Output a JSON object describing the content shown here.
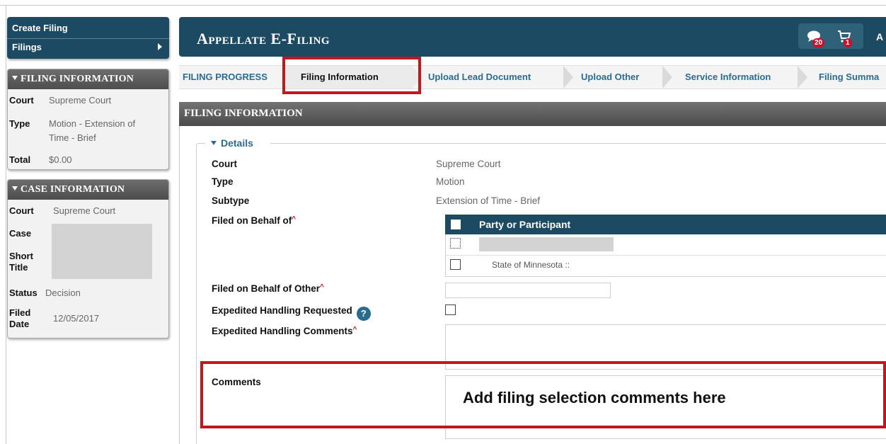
{
  "nav": {
    "create_filing": "Create Filing",
    "filings": "Filings"
  },
  "filing_info": {
    "header": "FILING INFORMATION",
    "court_key": "Court",
    "court": "Supreme Court",
    "type_key": "Type",
    "type_line1": "Motion - Extension of",
    "type_line2": "Time - Brief",
    "total_key": "Total",
    "total": "$0.00"
  },
  "case_info": {
    "header": "CASE INFORMATION",
    "court_key": "Court",
    "court": "Supreme Court",
    "case_key": "Case",
    "short_title_key_1": "Short",
    "short_title_key_2": "Title",
    "status_key": "Status",
    "status": "Decision",
    "filed_date_key_1": "Filed",
    "filed_date_key_2": "Date",
    "filed_date": "12/05/2017"
  },
  "header": {
    "title": "Appellate E-Filing",
    "messages_count": "20",
    "cart_count": "1",
    "user_initial": "A"
  },
  "progress": {
    "label": "FILING PROGRESS",
    "steps": [
      "Filing Information",
      "Upload Lead Document",
      "Upload Other",
      "Service Information",
      "Filing Summa"
    ],
    "current_step": 0
  },
  "section": {
    "title": "FILING INFORMATION",
    "legend": "Details"
  },
  "form": {
    "court_label": "Court",
    "court_value": "Supreme Court",
    "type_label": "Type",
    "type_value": "Motion",
    "subtype_label": "Subtype",
    "subtype_value": "Extension of Time - Brief",
    "filed_on_behalf_label": "Filed on Behalf of",
    "party_header": "Party or Participant",
    "party_rows": [
      "",
      "State of Minnesota ::"
    ],
    "filed_other_label": "Filed on Behalf of Other",
    "filed_other_value": "",
    "expedited_label": "Expedited Handling Requested",
    "expedited_checked": false,
    "expedited_comments_label": "Expedited Handling Comments",
    "comments_label": "Comments",
    "required_mark": "^",
    "help_mark": "?"
  },
  "annotation": {
    "callout": "Add filing selection comments here"
  },
  "colors": {
    "header_bg": "#1c4a63",
    "link": "#2b6c8e",
    "highlight_box": "#c0181f",
    "required": "#c0181f"
  }
}
